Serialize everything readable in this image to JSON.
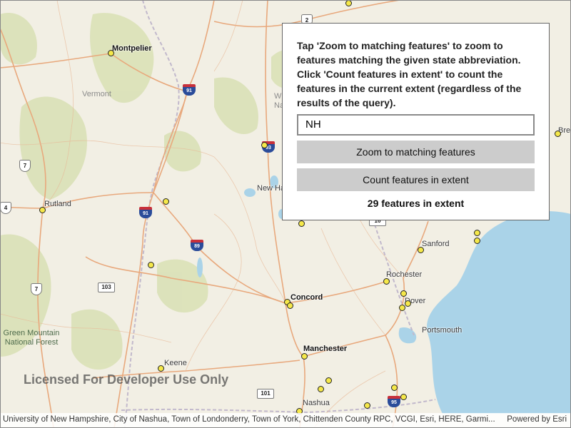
{
  "panel": {
    "instructions": "Tap 'Zoom to matching features' to zoom to features matching the given state abbreviation. Click 'Count features in extent' to count the features in the current extent (regardless of the results of the query).",
    "state_input_value": "NH",
    "zoom_button_label": "Zoom to matching features",
    "count_button_label": "Count features in extent",
    "result_text": "29 features in extent"
  },
  "map": {
    "watermark": "Licensed For Developer Use Only",
    "attribution": "University of New Hampshire, City of Nashua, Town of Londonderry, Town of York, Chittenden County RPC, VCGI, Esri, HERE, Garmi...",
    "powered_by": "Powered by Esri",
    "cities": {
      "montpelier": "Montpelier",
      "rutland": "Rutland",
      "keene": "Keene",
      "concord": "Concord",
      "manchester": "Manchester",
      "nashua": "Nashua",
      "rochester": "Rochester",
      "dover": "Dover",
      "portsmouth": "Portsmouth",
      "sanford": "Sanford",
      "new_ha": "New Ha",
      "bre": "Bre"
    },
    "regions": {
      "vermont": "Vermont",
      "forest": "Green Mountain National Forest",
      "w_fragment": "W",
      "na_fragment": "Na"
    },
    "shields": {
      "i91_top": "91",
      "i91_mid": "91",
      "i89": "89",
      "i93": "93",
      "i95": "95",
      "us7_a": "7",
      "us7_b": "7",
      "us2": "2",
      "us4": "4",
      "rt103": "103",
      "rt101": "101",
      "rt16": "16"
    },
    "colors": {
      "land": "#f2efe4",
      "forest": "#d9e0b4",
      "water": "#aad3e8",
      "major_road": "#e8a87c",
      "feature_dot": "#f5e84a"
    }
  }
}
